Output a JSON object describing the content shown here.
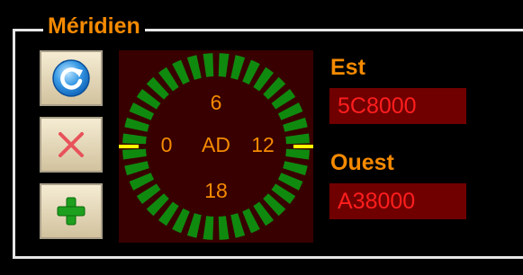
{
  "group_title": "Méridien",
  "buttons": [
    {
      "icon": "refresh-icon"
    },
    {
      "icon": "close-icon"
    },
    {
      "icon": "plus-icon"
    }
  ],
  "dial": {
    "center_label": "AD",
    "top_label": "6",
    "left_label": "0",
    "right_label": "12",
    "bottom_label": "18",
    "segments": 36,
    "colors": {
      "segment": "#0f8a0f",
      "inner": "#380000",
      "marker": "#ffff00"
    }
  },
  "est": {
    "label": "Est",
    "value": "5C8000"
  },
  "ouest": {
    "label": "Ouest",
    "value": "A38000"
  },
  "colors": {
    "accent": "#f58a00",
    "value_text": "#ff1e1e",
    "field_bg": "#700000"
  }
}
